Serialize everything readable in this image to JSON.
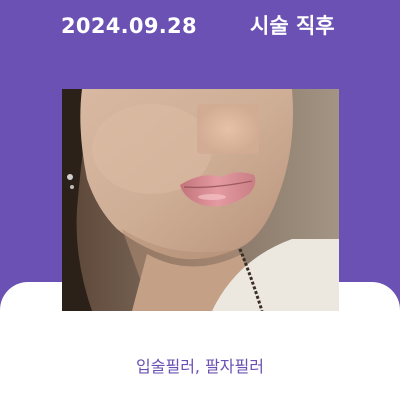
{
  "header": {
    "date": "2024.09.28",
    "label": "시술 직후"
  },
  "photo": {
    "subject": "face-photo"
  },
  "caption": {
    "text": "입술필러, 팔자필러"
  },
  "colors": {
    "accent": "#6a51b3",
    "card": "#ffffff"
  }
}
